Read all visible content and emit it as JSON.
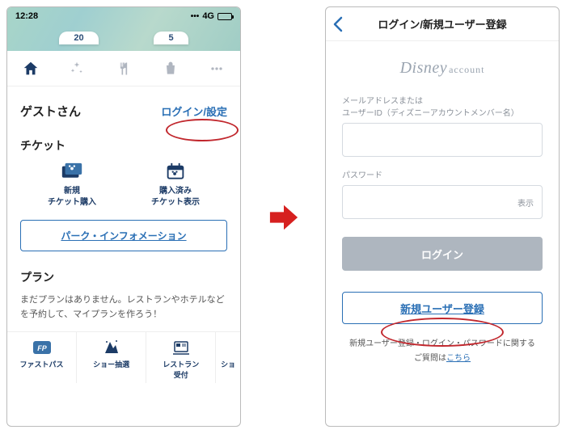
{
  "left": {
    "statusbar": {
      "time": "12:28",
      "net": "4G"
    },
    "map": {
      "chip1": "20",
      "chip2": "5"
    },
    "guest": {
      "name": "ゲストさん",
      "login_link": "ログイン/設定"
    },
    "ticket": {
      "heading": "チケット",
      "buy_l1": "新規",
      "buy_l2": "チケット購入",
      "show_l1": "購入済み",
      "show_l2": "チケット表示"
    },
    "park_info": "パーク・インフォメーション",
    "plan": {
      "heading": "プラン",
      "desc": "まだプランはありません。レストランやホテルなどを予約して、マイプランを作ろう！",
      "fp": "ファストパス",
      "show": "ショー抽選",
      "rest_l1": "レストラン",
      "rest_l2": "受付",
      "more": "ショ"
    }
  },
  "right": {
    "title": "ログイン/新規ユーザー登録",
    "logo": "Disney",
    "logo_sub": "account",
    "email_label_l1": "メールアドレスまたは",
    "email_label_l2": "ユーザーID（ディズニーアカウントメンバー名）",
    "password_label": "パスワード",
    "show_pw": "表示",
    "login_btn": "ログイン",
    "signup_btn": "新規ユーザー登録",
    "help_l1": "新規ユーザー登録・ログイン・パスワードに関する",
    "help_l2a": "ご質問は",
    "help_link": "こちら"
  }
}
